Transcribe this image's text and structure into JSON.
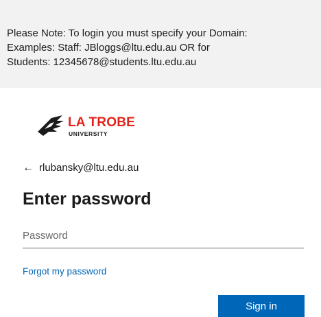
{
  "banner": {
    "lines": [
      "Please Note: To login you must specify your Domain:",
      "Examples: Staff: JBloggs@ltu.edu.au OR for",
      "Students: 12345678@students.ltu.edu.au"
    ]
  },
  "logo": {
    "name": "LA TROBE",
    "subtitle": "UNIVERSITY",
    "brand_color": "#e2231a"
  },
  "identity": {
    "icon": "back-arrow-icon",
    "email": "rlubansky@ltu.edu.au"
  },
  "form": {
    "title": "Enter password",
    "password_placeholder": "Password",
    "forgot_label": "Forgot my password",
    "signin_label": "Sign in"
  },
  "colors": {
    "accent": "#0067b8",
    "banner_bg": "#f2f2f2"
  }
}
